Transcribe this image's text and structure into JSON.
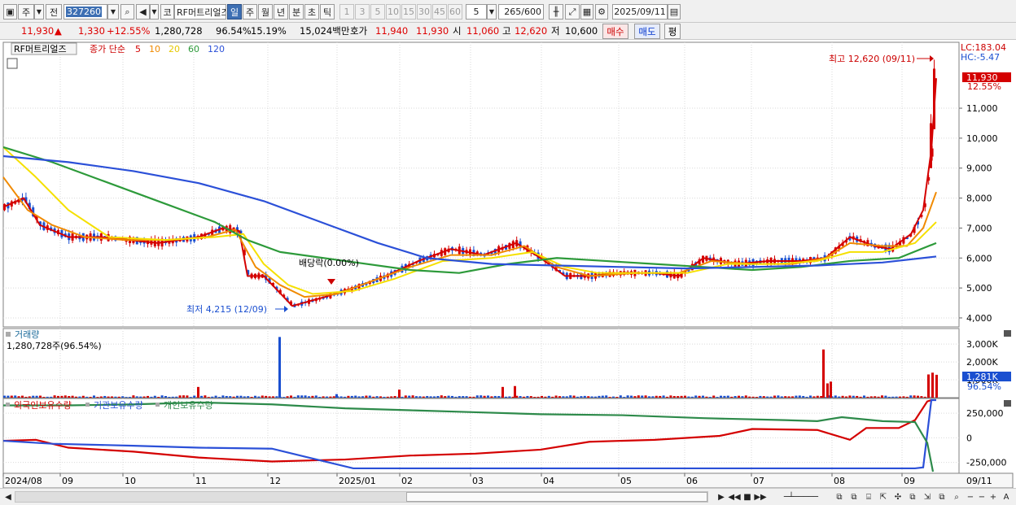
{
  "toolbar": {
    "period_type": "주",
    "prev_label": "전",
    "code": "327260",
    "code_btn": "코",
    "stock_name": "RF머트리얼즈",
    "periods": [
      "일",
      "주",
      "월",
      "년",
      "분",
      "초",
      "틱"
    ],
    "active_period": "일",
    "intervals": [
      "1",
      "3",
      "5",
      "10",
      "15",
      "30",
      "45",
      "60"
    ],
    "interval_value": "5",
    "count": "265",
    "count_max": "/600",
    "date": "2025/09/11"
  },
  "quote": {
    "price": "11,930",
    "arrow": "▲",
    "change": "1,330",
    "change_pct": "+12.55%",
    "volume": "1,280,728",
    "vol_ratio": "96.54%",
    "turnover": "15.19%",
    "amount": "15,024백만",
    "bid_label": "호가",
    "ask_price": "11,940",
    "bid_price": "11,930",
    "open_label": "시",
    "open": "11,060",
    "high_label": "고",
    "high": "12,620",
    "low_label": "저",
    "low": "10,600",
    "buy": "매수",
    "sell": "매도",
    "eval": "평"
  },
  "price_panel": {
    "legend_name": "RF머트리얼즈",
    "legend_ma": "종가 단순",
    "ma_periods": [
      "5",
      "10",
      "20",
      "60",
      "120"
    ],
    "ma_colors": [
      "#d40000",
      "#f08a00",
      "#f5e000",
      "#2d9a3a",
      "#2b50d8"
    ],
    "lc": "LC:183.04",
    "hc": "HC:-5.47",
    "last_price": "11,930",
    "last_pct": "12.55%",
    "y_ticks": [
      "4,000",
      "5,000",
      "6,000",
      "7,000",
      "8,000",
      "9,000",
      "10,000",
      "11,000"
    ],
    "high_note": "최고 12,620 (09/11)",
    "low_note": "최저 4,215 (12/09)",
    "div_note": "배당락(0.00%)"
  },
  "volume_panel": {
    "title": "거래량",
    "value": "1,280,728주(96.54%)",
    "y_ticks": [
      "1,000K",
      "2,000K",
      "3,000K"
    ],
    "last": "1,281K",
    "last_pct": "96.54%"
  },
  "holder_panel": {
    "series": [
      "외국인보유수량",
      "기관보유수량",
      "개인보유수량"
    ],
    "series_colors": [
      "#d40000",
      "#2b50d8",
      "#2d8a4a"
    ],
    "y_ticks": [
      "250,000",
      "0",
      "-250,000"
    ]
  },
  "x_axis": {
    "labels": [
      "2024/08",
      "09",
      "10",
      "11",
      "12",
      "2025/01",
      "02",
      "03",
      "04",
      "05",
      "06",
      "07",
      "08",
      "09"
    ],
    "last": "09/11"
  },
  "chart_data": {
    "type": "candlestick",
    "y_unit": "KRW",
    "ylim": [
      3700,
      13200
    ],
    "high": {
      "value": 12620,
      "date": "09/11"
    },
    "low": {
      "value": 4215,
      "date": "12/09"
    },
    "ma5": [
      [
        0,
        7700
      ],
      [
        25,
        8000
      ],
      [
        45,
        7100
      ],
      [
        80,
        6700
      ],
      [
        120,
        6700
      ],
      [
        190,
        6500
      ],
      [
        240,
        6700
      ],
      [
        270,
        7000
      ],
      [
        290,
        6900
      ],
      [
        300,
        5400
      ],
      [
        320,
        5400
      ],
      [
        355,
        4400
      ],
      [
        395,
        4700
      ],
      [
        430,
        5000
      ],
      [
        470,
        5400
      ],
      [
        510,
        5900
      ],
      [
        550,
        6300
      ],
      [
        590,
        6100
      ],
      [
        630,
        6500
      ],
      [
        660,
        6000
      ],
      [
        690,
        5400
      ],
      [
        720,
        5400
      ],
      [
        760,
        5500
      ],
      [
        800,
        5500
      ],
      [
        830,
        5400
      ],
      [
        860,
        6000
      ],
      [
        900,
        5800
      ],
      [
        940,
        5900
      ],
      [
        980,
        5900
      ],
      [
        1010,
        6000
      ],
      [
        1040,
        6700
      ],
      [
        1070,
        6400
      ],
      [
        1090,
        6300
      ],
      [
        1115,
        6800
      ],
      [
        1130,
        7600
      ],
      [
        1140,
        9600
      ],
      [
        1146,
        12000
      ]
    ],
    "ma10": [
      [
        0,
        8700
      ],
      [
        30,
        7600
      ],
      [
        60,
        7100
      ],
      [
        100,
        6700
      ],
      [
        150,
        6600
      ],
      [
        200,
        6600
      ],
      [
        250,
        6700
      ],
      [
        285,
        6950
      ],
      [
        310,
        5700
      ],
      [
        340,
        5100
      ],
      [
        370,
        4700
      ],
      [
        410,
        4800
      ],
      [
        460,
        5300
      ],
      [
        500,
        5700
      ],
      [
        550,
        6100
      ],
      [
        600,
        6100
      ],
      [
        640,
        6400
      ],
      [
        680,
        5700
      ],
      [
        720,
        5400
      ],
      [
        780,
        5500
      ],
      [
        830,
        5500
      ],
      [
        870,
        5900
      ],
      [
        920,
        5800
      ],
      [
        970,
        5800
      ],
      [
        1010,
        6000
      ],
      [
        1040,
        6500
      ],
      [
        1080,
        6400
      ],
      [
        1110,
        6400
      ],
      [
        1130,
        7000
      ],
      [
        1146,
        8200
      ]
    ],
    "ma20": [
      [
        0,
        9700
      ],
      [
        40,
        8700
      ],
      [
        80,
        7600
      ],
      [
        130,
        6700
      ],
      [
        200,
        6600
      ],
      [
        260,
        6700
      ],
      [
        295,
        6800
      ],
      [
        320,
        5800
      ],
      [
        350,
        5100
      ],
      [
        380,
        4800
      ],
      [
        430,
        4900
      ],
      [
        480,
        5300
      ],
      [
        540,
        5900
      ],
      [
        600,
        6000
      ],
      [
        650,
        6200
      ],
      [
        690,
        5700
      ],
      [
        730,
        5500
      ],
      [
        790,
        5500
      ],
      [
        840,
        5500
      ],
      [
        890,
        5800
      ],
      [
        950,
        5800
      ],
      [
        1000,
        5900
      ],
      [
        1040,
        6200
      ],
      [
        1080,
        6200
      ],
      [
        1120,
        6500
      ],
      [
        1146,
        7200
      ]
    ],
    "ma60": [
      [
        0,
        9700
      ],
      [
        60,
        9200
      ],
      [
        120,
        8600
      ],
      [
        200,
        7800
      ],
      [
        260,
        7200
      ],
      [
        300,
        6600
      ],
      [
        340,
        6200
      ],
      [
        420,
        5900
      ],
      [
        500,
        5600
      ],
      [
        560,
        5500
      ],
      [
        620,
        5800
      ],
      [
        680,
        6000
      ],
      [
        740,
        5900
      ],
      [
        800,
        5800
      ],
      [
        860,
        5700
      ],
      [
        920,
        5600
      ],
      [
        980,
        5700
      ],
      [
        1040,
        5900
      ],
      [
        1100,
        6000
      ],
      [
        1146,
        6500
      ]
    ],
    "ma120": [
      [
        0,
        9400
      ],
      [
        80,
        9200
      ],
      [
        160,
        8900
      ],
      [
        240,
        8500
      ],
      [
        320,
        7900
      ],
      [
        400,
        7100
      ],
      [
        460,
        6500
      ],
      [
        520,
        6000
      ],
      [
        600,
        5800
      ],
      [
        680,
        5750
      ],
      [
        760,
        5700
      ],
      [
        840,
        5650
      ],
      [
        920,
        5700
      ],
      [
        1000,
        5750
      ],
      [
        1080,
        5850
      ],
      [
        1146,
        6050
      ]
    ],
    "volume_spikes_k": [
      [
        238,
        600
      ],
      [
        338,
        3400
      ],
      [
        408,
        200
      ],
      [
        485,
        450
      ],
      [
        612,
        600
      ],
      [
        627,
        650
      ],
      [
        1006,
        2700
      ],
      [
        1011,
        800
      ],
      [
        1015,
        900
      ],
      [
        1135,
        1300
      ],
      [
        1140,
        1400
      ],
      [
        1145,
        1281
      ]
    ]
  }
}
